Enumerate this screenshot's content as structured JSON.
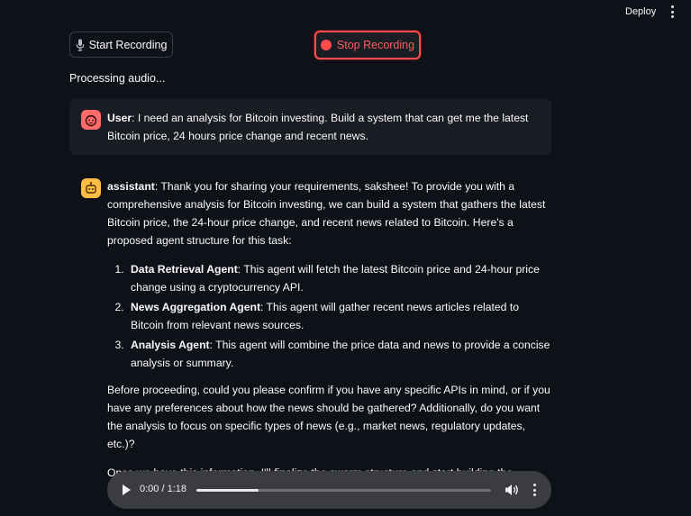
{
  "header": {
    "deploy_label": "Deploy",
    "menu_icon": "kebab-menu-icon"
  },
  "controls": {
    "start_label": "Start Recording",
    "start_icon": "microphone-icon",
    "stop_label": "Stop Recording",
    "stop_icon": "record-dot-icon",
    "stop_accent": "#ff4b4b"
  },
  "status": "Processing audio...",
  "chat": {
    "user": {
      "role": "User",
      "text": ": I need an analysis for Bitcoin investing. Build a system that can get me the latest Bitcoin price, 24 hours price change and recent news.",
      "avatar_icon": "user-face-icon",
      "avatar_color": "#ff6b6b"
    },
    "assistant": {
      "role": "assistant",
      "intro": ": Thank you for sharing your requirements, sakshee! To provide you with a comprehensive analysis for Bitcoin investing, we can build a system that gathers the latest Bitcoin price, the 24-hour price change, and recent news related to Bitcoin. Here's a proposed agent structure for this task:",
      "agents": [
        {
          "name": "Data Retrieval Agent",
          "desc": ": This agent will fetch the latest Bitcoin price and 24-hour price change using a cryptocurrency API."
        },
        {
          "name": "News Aggregation Agent",
          "desc": ": This agent will gather recent news articles related to Bitcoin from relevant news sources."
        },
        {
          "name": "Analysis Agent",
          "desc": ": This agent will combine the price data and news to provide a concise analysis or summary."
        }
      ],
      "question": "Before proceeding, could you please confirm if you have any specific APIs in mind, or if you have any preferences about how the news should be gathered? Additionally, do you want the analysis to focus on specific types of news (e.g., market news, regulatory updates, etc.)?",
      "closing": "Once we have this information, I'll finalize the swarm structure and start building the agents.",
      "avatar_icon": "robot-icon",
      "avatar_color": "#ffbd45"
    }
  },
  "audio": {
    "time": "0:00 / 1:18",
    "progress_fraction": 0.21,
    "play_icon": "play-icon",
    "volume_icon": "volume-icon",
    "more_icon": "kebab-menu-icon"
  }
}
